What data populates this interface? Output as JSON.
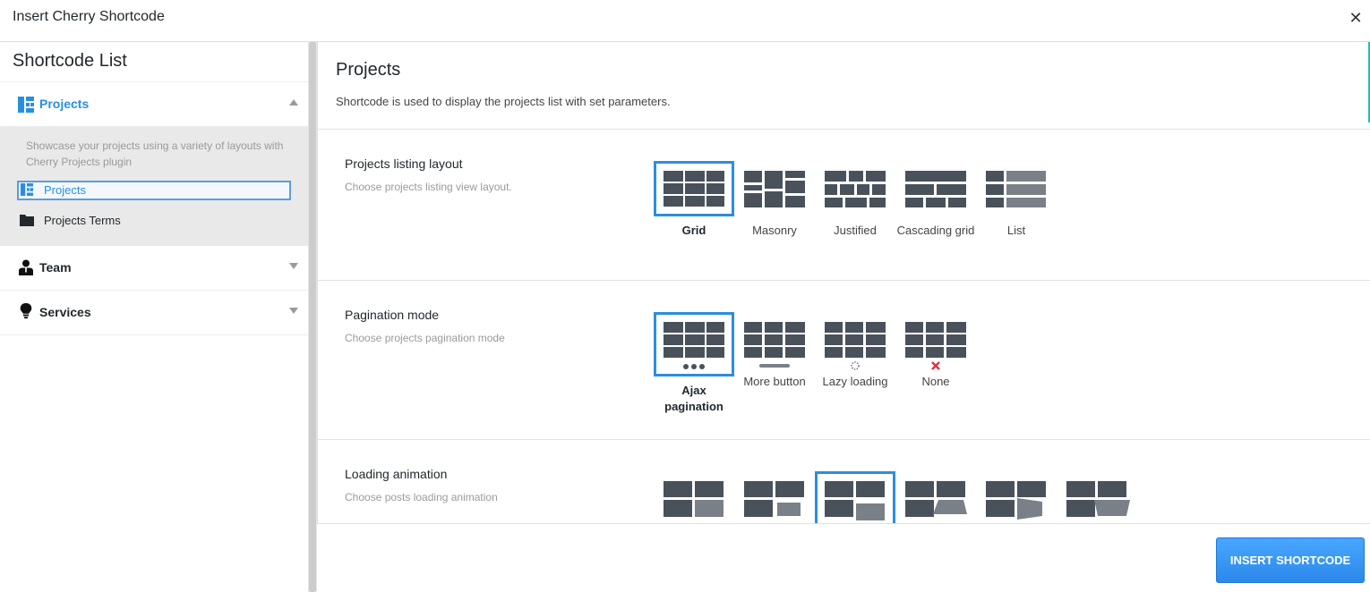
{
  "window": {
    "title": "Insert Cherry Shortcode",
    "close_symbol": "✕"
  },
  "sidebar": {
    "heading": "Shortcode List",
    "groups": [
      {
        "label": "Projects",
        "icon": "projects-grid-icon",
        "expanded": true,
        "description": "Showcase your projects using a variety of layouts with Cherry Projects plugin",
        "items": [
          {
            "label": "Projects",
            "icon": "projects-grid-icon",
            "selected": true
          },
          {
            "label": "Projects Terms",
            "icon": "folder-icon",
            "selected": false
          }
        ]
      },
      {
        "label": "Team",
        "icon": "team-user-icon",
        "expanded": false
      },
      {
        "label": "Services",
        "icon": "lightbulb-icon",
        "expanded": false
      }
    ]
  },
  "main": {
    "title": "Projects",
    "description": "Shortcode is used to display the projects list with set parameters.",
    "sections": [
      {
        "title": "Projects listing layout",
        "description": "Choose projects listing view layout.",
        "options": [
          {
            "label": "Grid",
            "selected": true
          },
          {
            "label": "Masonry",
            "selected": false
          },
          {
            "label": "Justified",
            "selected": false
          },
          {
            "label": "Cascading grid",
            "selected": false
          },
          {
            "label": "List",
            "selected": false
          }
        ]
      },
      {
        "title": "Pagination mode",
        "description": "Choose projects pagination mode",
        "options": [
          {
            "label": "Ajax pagination",
            "selected": true
          },
          {
            "label": "More button",
            "selected": false
          },
          {
            "label": "Lazy loading",
            "selected": false
          },
          {
            "label": "None",
            "selected": false
          }
        ]
      },
      {
        "title": "Loading animation",
        "description": "Choose posts loading animation",
        "options": [
          {
            "selected": false
          },
          {
            "selected": false
          },
          {
            "selected": true
          },
          {
            "selected": false
          },
          {
            "selected": false
          },
          {
            "selected": false
          }
        ]
      }
    ]
  },
  "footer": {
    "insert_label": "INSERT SHORTCODE"
  },
  "colors": {
    "accent": "#2a8ee0",
    "block": "#49525a",
    "block_light": "#7a8087",
    "none_mark": "#d9363e"
  }
}
